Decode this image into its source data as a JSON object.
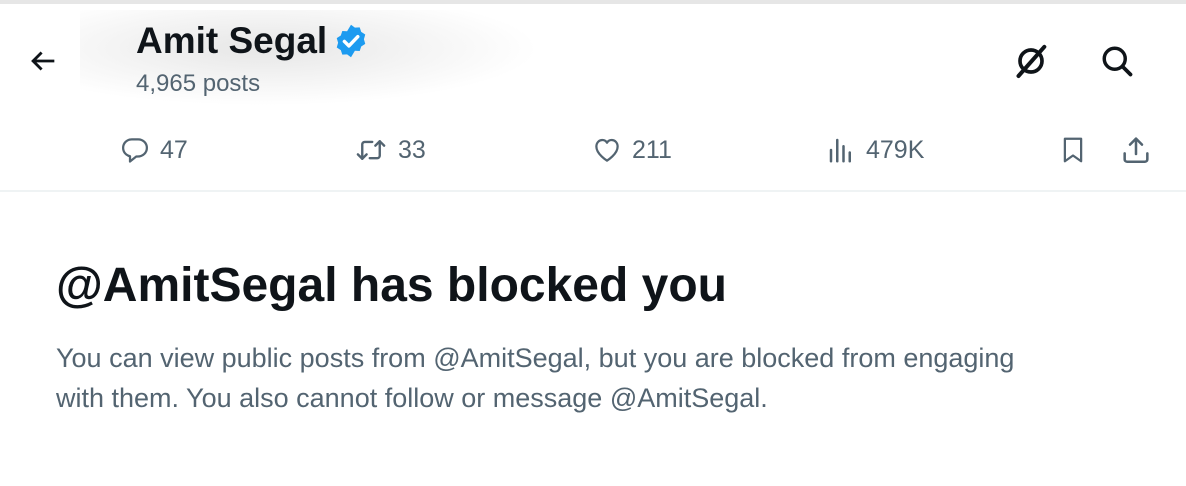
{
  "header": {
    "name": "Amit Segal",
    "posts_count": "4,965 posts",
    "icons": {
      "back": "arrow-left-icon",
      "verified": "verified-badge-icon",
      "grok": "grok-icon",
      "search": "search-icon"
    },
    "accent_color": "#1d9bf0"
  },
  "actions": {
    "reply": {
      "icon": "reply-icon",
      "count": "47"
    },
    "repost": {
      "icon": "repost-icon",
      "count": "33"
    },
    "like": {
      "icon": "heart-icon",
      "count": "211"
    },
    "views": {
      "icon": "views-icon",
      "count": "479K"
    },
    "bookmark": {
      "icon": "bookmark-icon"
    },
    "share": {
      "icon": "share-icon"
    }
  },
  "blocked": {
    "title": "@AmitSegal has blocked you",
    "description": "You can view public posts from @AmitSegal, but you are blocked from engaging with them. You also cannot follow or message @AmitSegal."
  }
}
